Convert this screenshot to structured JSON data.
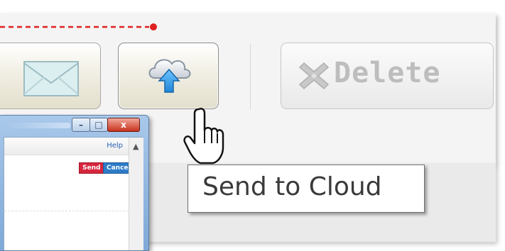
{
  "toolbar": {
    "mail_icon": "envelope-icon",
    "cloud_icon": "cloud-upload-icon",
    "delete_icon": "delete-x-icon",
    "delete_label": "Delete",
    "delete_enabled": false
  },
  "tooltip": {
    "text": "Send to Cloud"
  },
  "cursor": {
    "icon": "hand-pointer-icon"
  },
  "mini_window": {
    "help_label": "Help",
    "send_label": "Send",
    "cancel_label": "Cancel",
    "minimize_glyph": "–",
    "maximize_glyph": "□",
    "close_glyph": "x"
  },
  "colors": {
    "callout_red": "#e02020",
    "send_red": "#d7263d",
    "cancel_blue": "#2e7bc8",
    "cloud_blue": "#1f86d8"
  }
}
